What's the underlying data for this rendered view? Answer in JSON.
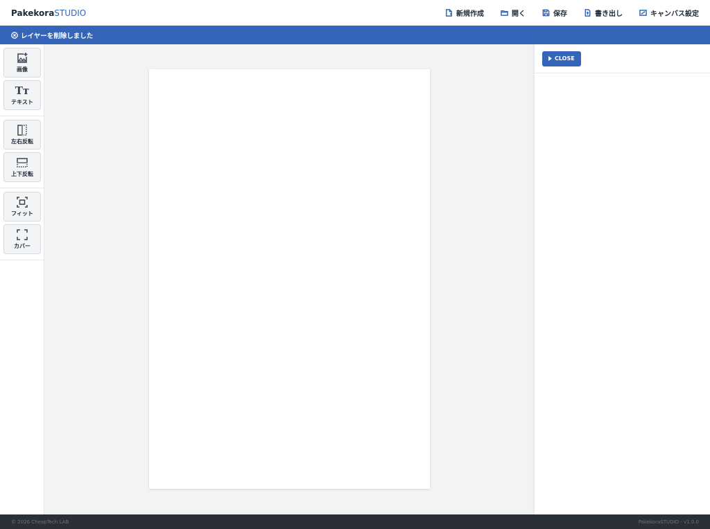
{
  "header": {
    "logo_bold": "Pakekora",
    "logo_light": "STUDIO",
    "nav": [
      {
        "label": "新規作成",
        "icon": "new-file-icon"
      },
      {
        "label": "開く",
        "icon": "folder-open-icon"
      },
      {
        "label": "保存",
        "icon": "save-icon"
      },
      {
        "label": "書き出し",
        "icon": "export-icon"
      },
      {
        "label": "キャンバス設定",
        "icon": "canvas-settings-icon"
      }
    ]
  },
  "notice": {
    "text": "レイヤーを削除しました",
    "icon": "close-circle-icon"
  },
  "toolbar": {
    "groups": [
      [
        {
          "label": "画像",
          "icon": "add-image-icon"
        },
        {
          "label": "テキスト",
          "icon": "text-icon",
          "glyph": "Tт"
        }
      ],
      [
        {
          "label": "左右反転",
          "icon": "flip-horizontal-icon"
        },
        {
          "label": "上下反転",
          "icon": "flip-vertical-icon"
        }
      ],
      [
        {
          "label": "フィット",
          "icon": "fit-icon"
        },
        {
          "label": "カバー",
          "icon": "cover-icon"
        }
      ]
    ]
  },
  "panel": {
    "close_label": "CLOSE"
  },
  "footer": {
    "copyright": "© 2026 CheapTech LAB",
    "version": "PakekoraSTUDIO - v1.0.0"
  },
  "colors": {
    "accent": "#3565b8",
    "canvas_bg": "#f2f3f5",
    "footer_bg": "#2b2f36"
  }
}
